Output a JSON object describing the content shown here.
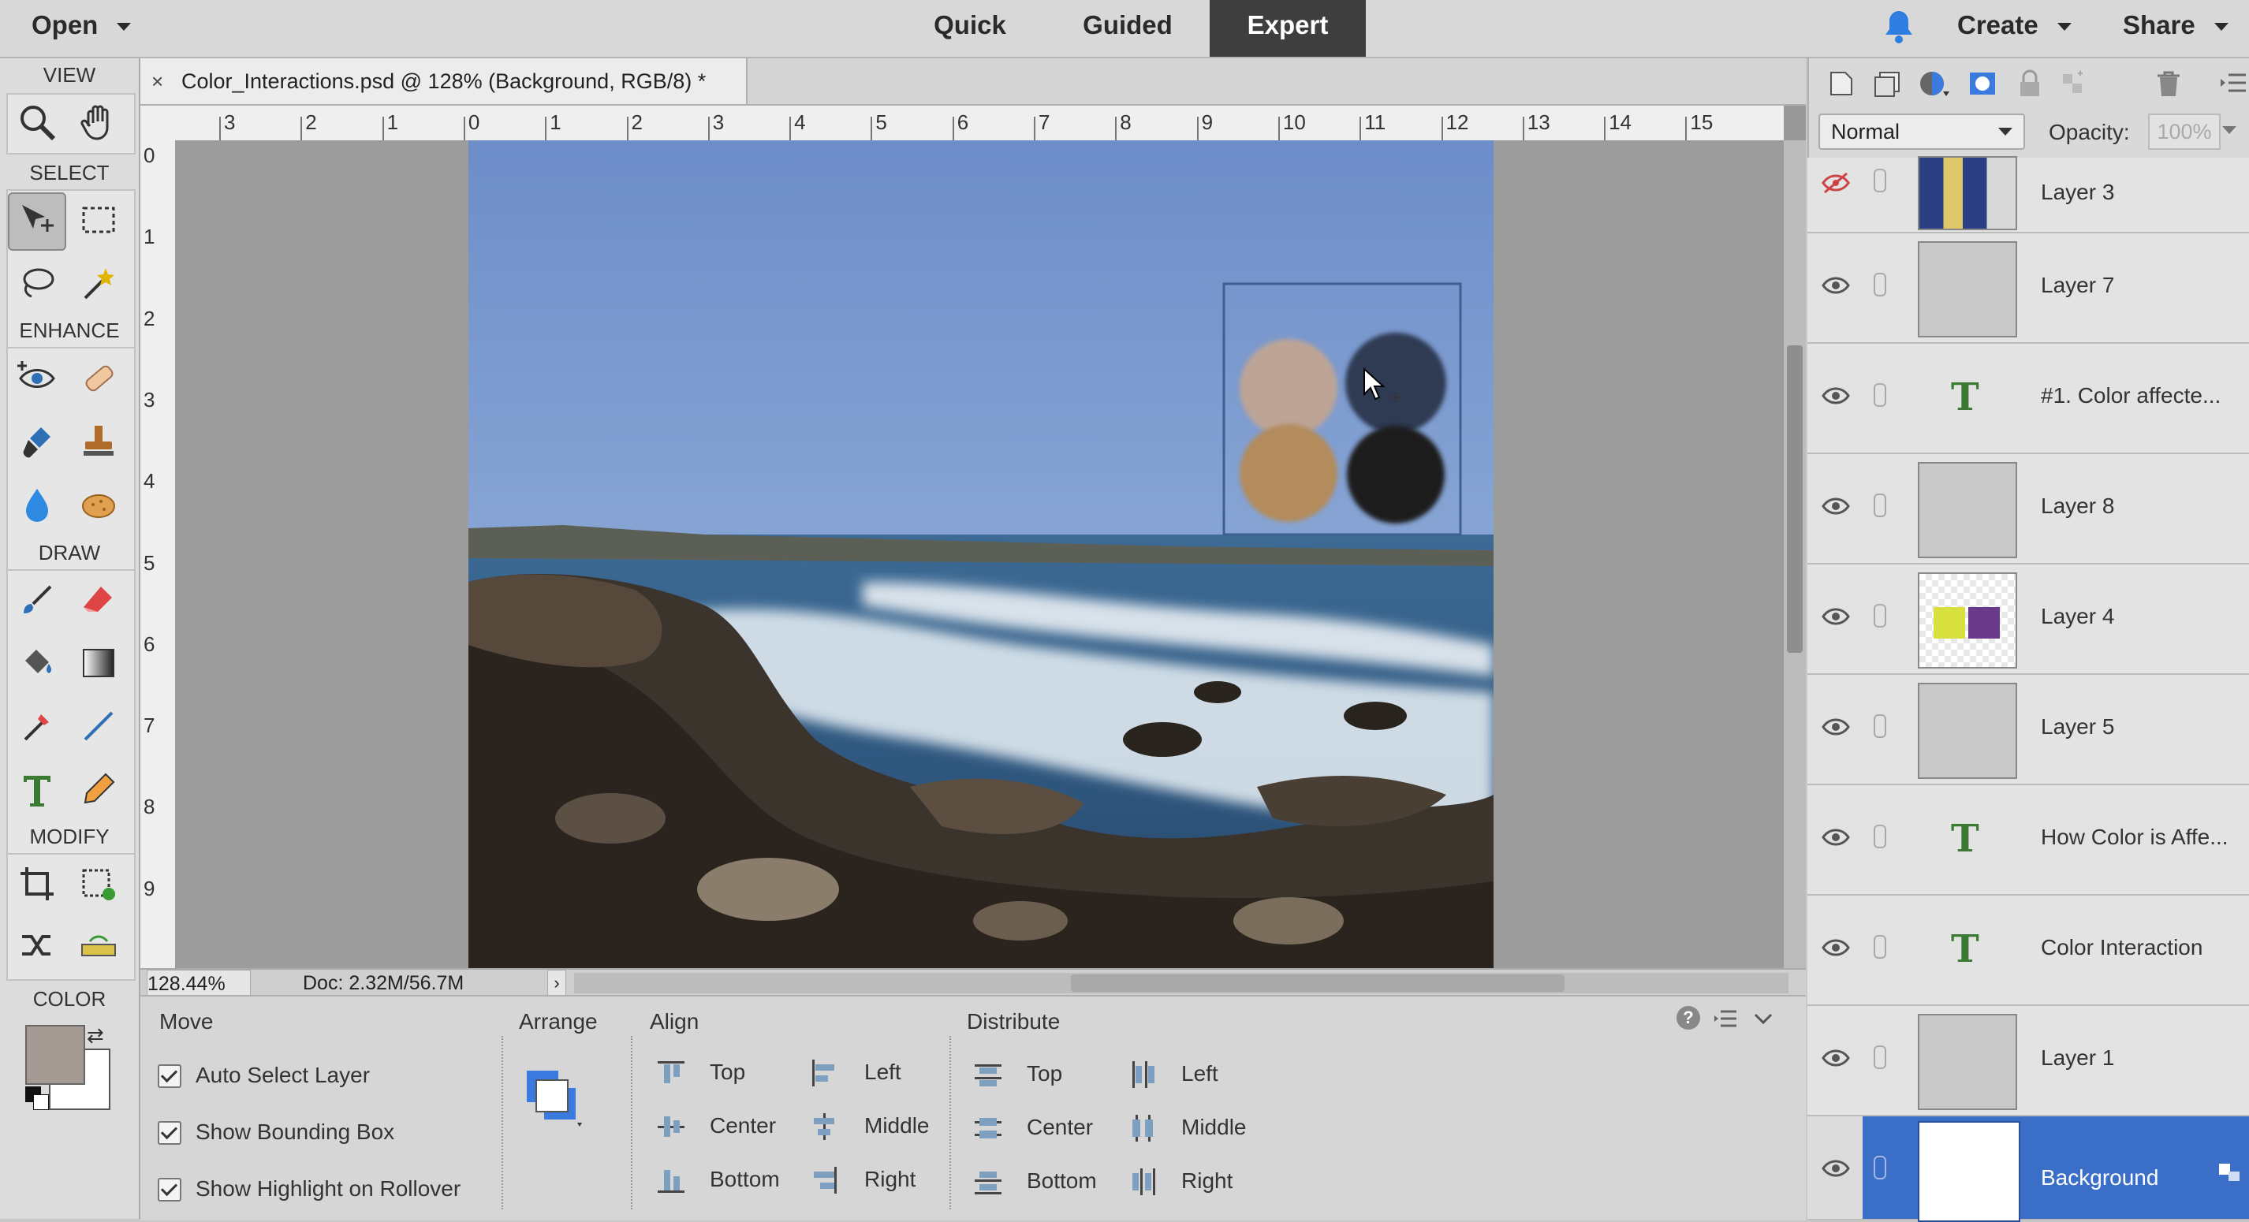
{
  "topbar": {
    "open_label": "Open",
    "modes": [
      "Quick",
      "Guided",
      "Expert"
    ],
    "active_mode": "Expert",
    "create_label": "Create",
    "share_label": "Share"
  },
  "toolbox": {
    "sections": {
      "view": "VIEW",
      "select": "SELECT",
      "enhance": "ENHANCE",
      "draw": "DRAW",
      "modify": "MODIFY",
      "color": "COLOR"
    },
    "foreground_color": "#a59a93",
    "background_color": "#ffffff"
  },
  "document": {
    "tab_title": "Color_Interactions.psd @ 128% (Background, RGB/8) *",
    "close_symbol": "×",
    "h_ruler": [
      "3",
      "2",
      "1",
      "0",
      "1",
      "2",
      "3",
      "4",
      "5",
      "6",
      "7",
      "8",
      "9",
      "10",
      "11",
      "12",
      "13",
      "14",
      "15"
    ],
    "v_ruler": [
      "0",
      "1",
      "2",
      "3",
      "4",
      "5",
      "6",
      "7",
      "8",
      "9"
    ],
    "zoom": "128.44%",
    "doc_size": "Doc: 2.32M/56.7M"
  },
  "options": {
    "move_title": "Move",
    "auto_select": "Auto Select Layer",
    "show_bounding": "Show Bounding Box",
    "show_highlight": "Show Highlight on Rollover",
    "arrange_title": "Arrange",
    "align_title": "Align",
    "align": {
      "top": "Top",
      "center": "Center",
      "bottom": "Bottom",
      "left": "Left",
      "middle": "Middle",
      "right": "Right"
    },
    "distribute_title": "Distribute",
    "distribute": {
      "top": "Top",
      "center": "Center",
      "bottom": "Bottom",
      "left": "Left",
      "middle": "Middle",
      "right": "Right"
    }
  },
  "layers": {
    "blend_mode": "Normal",
    "opacity_label": "Opacity:",
    "opacity_value": "100%",
    "items": [
      {
        "name": "Layer 3"
      },
      {
        "name": "Layer 7"
      },
      {
        "name": "#1. Color affecte..."
      },
      {
        "name": "Layer 8"
      },
      {
        "name": "Layer 4"
      },
      {
        "name": "Layer 5"
      },
      {
        "name": "How Color is Affe..."
      },
      {
        "name": "Color Interaction"
      },
      {
        "name": "Layer 1"
      },
      {
        "name": "Background"
      }
    ]
  }
}
